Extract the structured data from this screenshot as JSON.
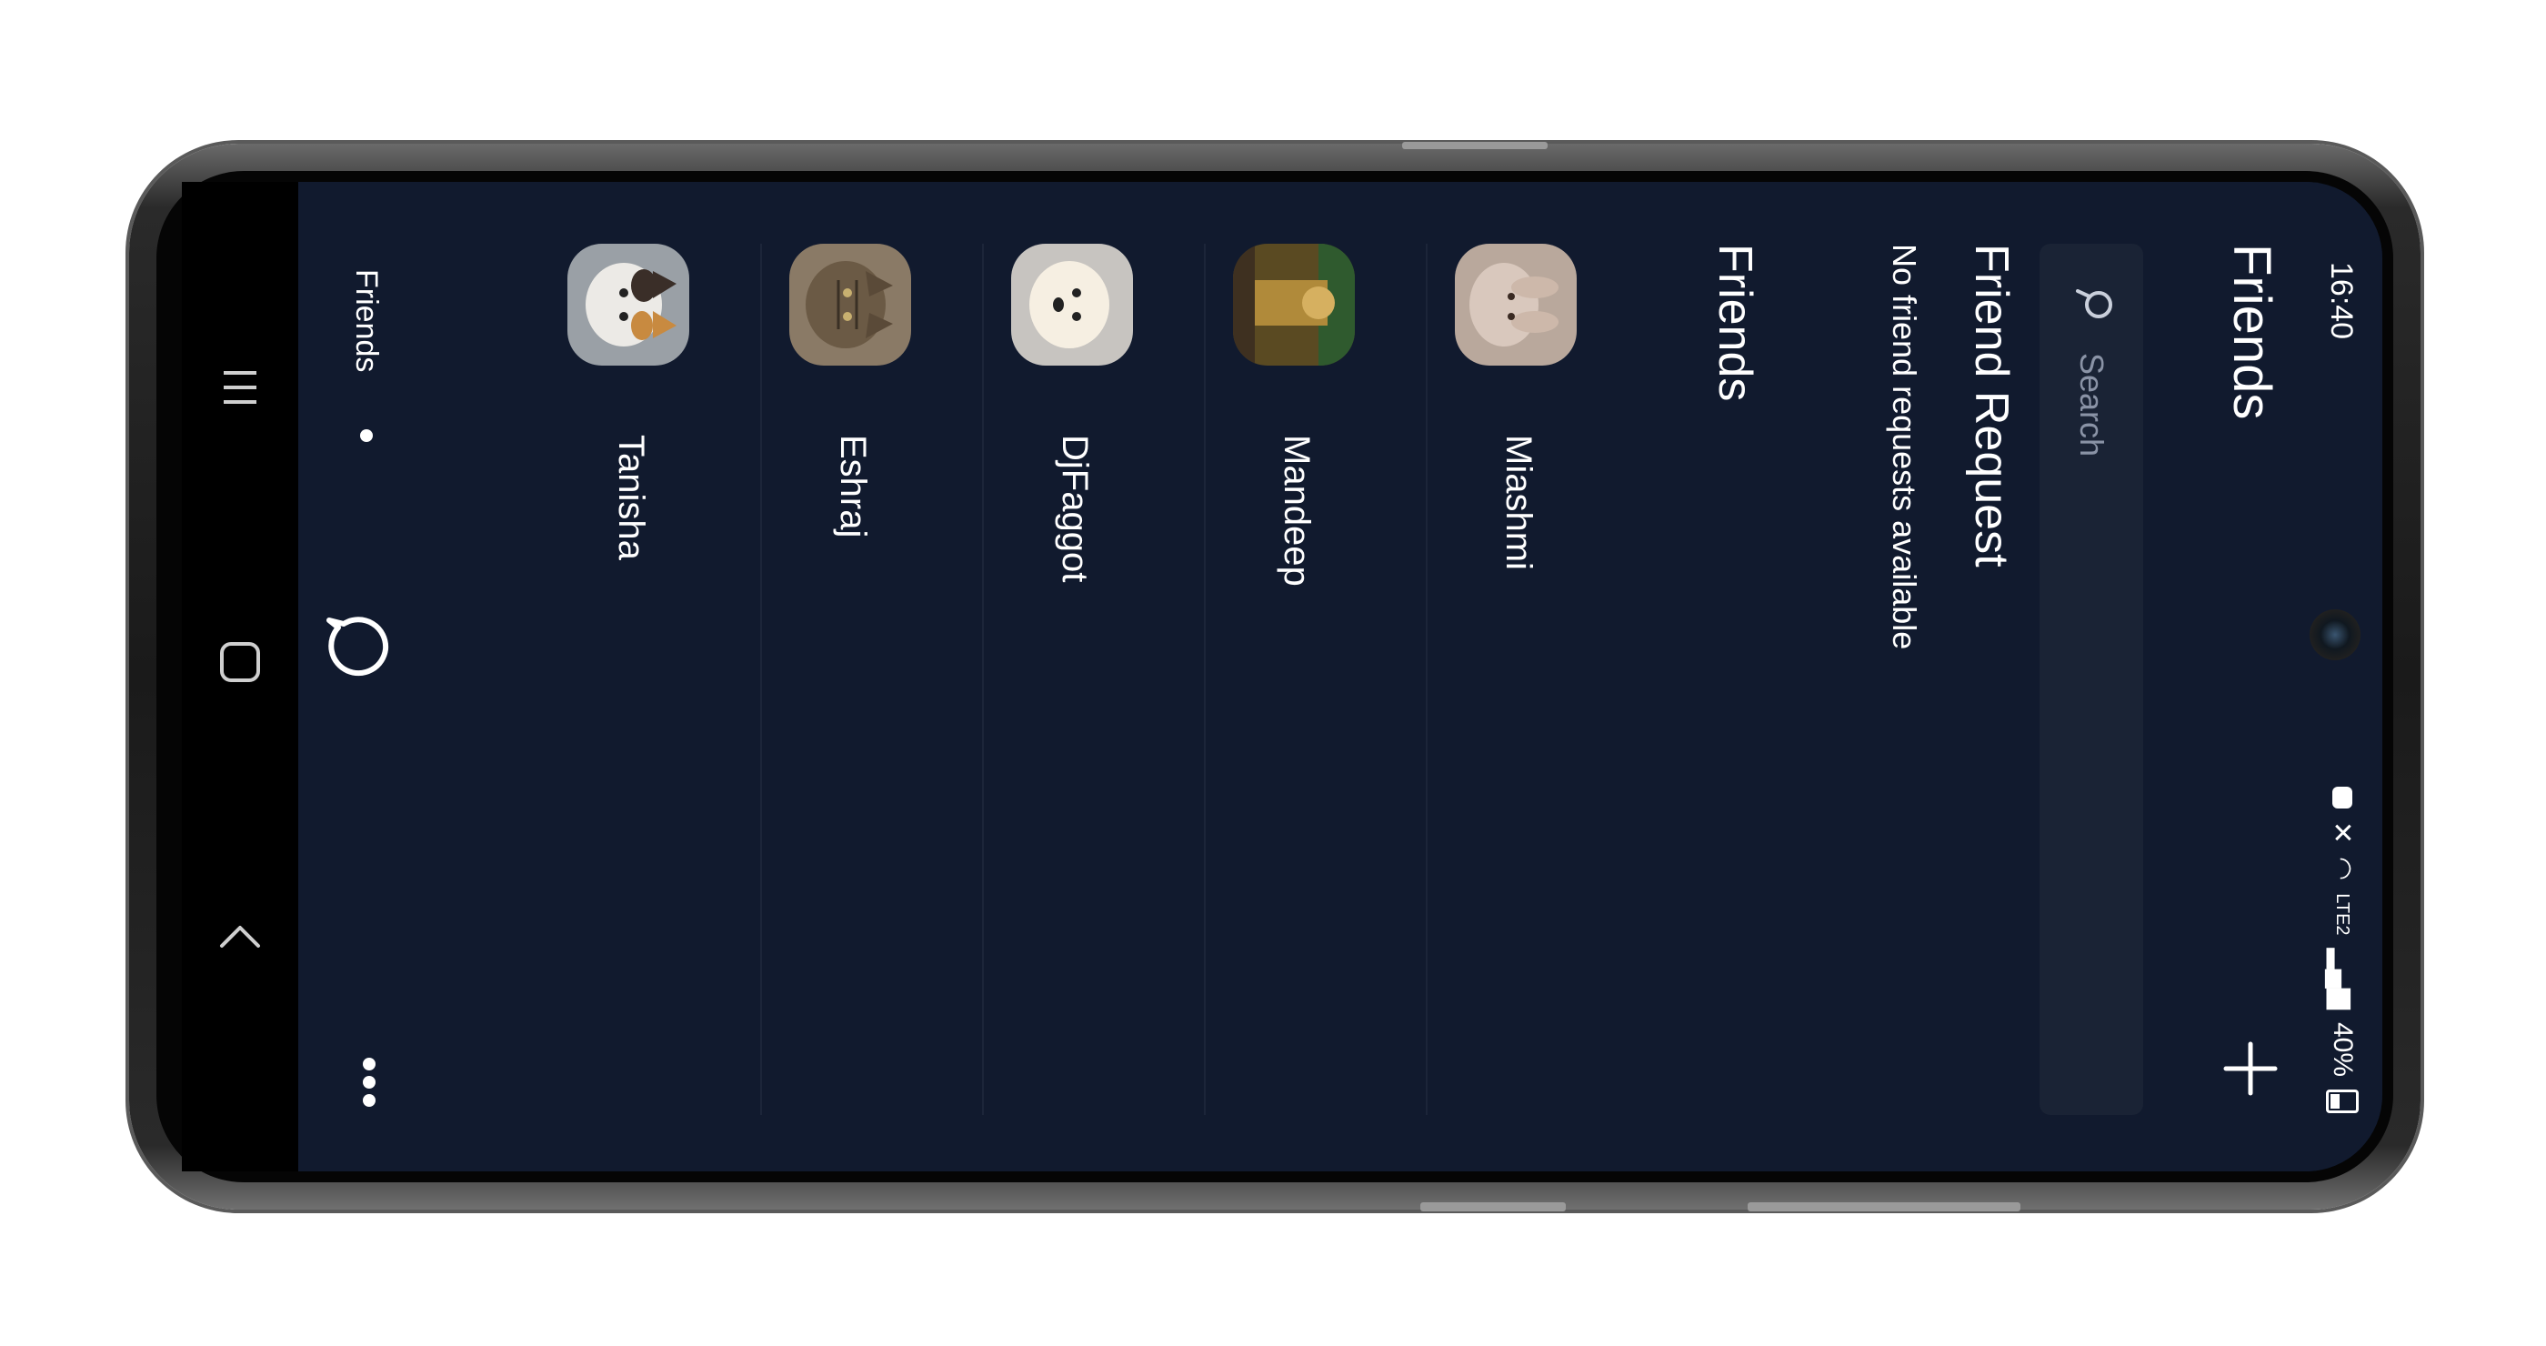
{
  "status_bar": {
    "time": "16:40",
    "battery_percent": "40%",
    "network": "LTE2",
    "icons": [
      "battery-saver-icon",
      "mute-icon",
      "wifi-calling-icon",
      "signal-icon",
      "battery-icon"
    ]
  },
  "header": {
    "title": "Friends",
    "add_icon": "plus-icon"
  },
  "search": {
    "placeholder": "Search",
    "value": ""
  },
  "friend_requests": {
    "heading": "Friend Request",
    "empty_text": "No friend requests available"
  },
  "friends": {
    "heading": "Friends",
    "items": [
      {
        "name": "Miashmi"
      },
      {
        "name": "Mandeep"
      },
      {
        "name": "DjFaggot"
      },
      {
        "name": "Eshraj"
      },
      {
        "name": "Tanisha"
      }
    ]
  },
  "bottom_nav": {
    "friends_label": "Friends",
    "chat_icon": "chat-bubble-icon",
    "more_icon": "more-dots-icon"
  },
  "system_nav": {
    "icons": [
      "recent-apps-icon",
      "home-icon",
      "back-icon"
    ]
  },
  "colors": {
    "app_background": "#111a2e",
    "search_background": "#1a2335",
    "divider": "#1c2539",
    "text": "#ffffff",
    "placeholder": "#8a93a6"
  }
}
